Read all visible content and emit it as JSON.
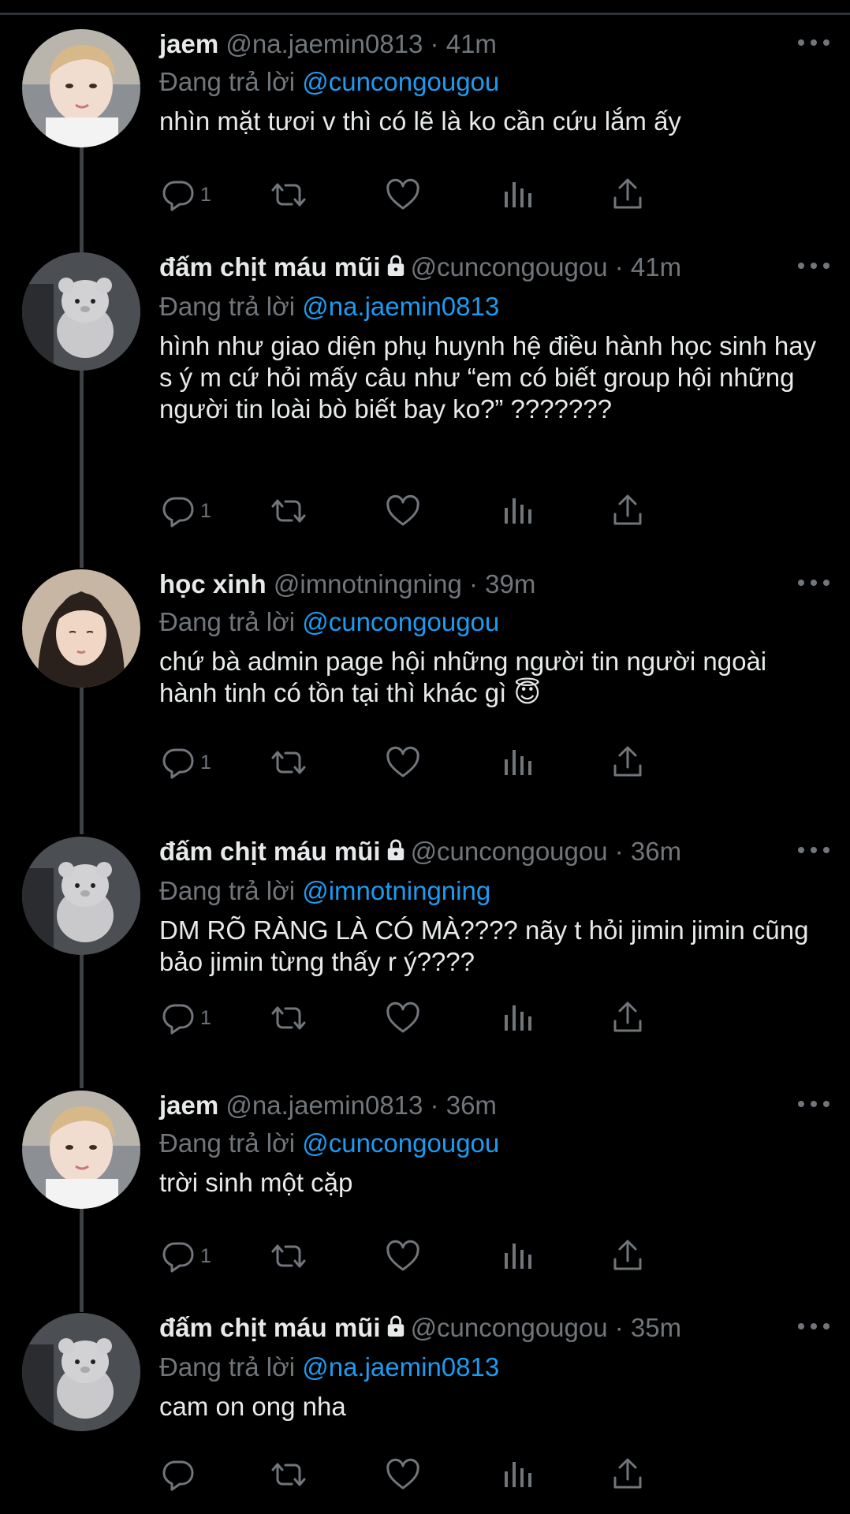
{
  "tweets": [
    {
      "name": "jaem",
      "handle": "@na.jaemin0813",
      "time": "41m",
      "locked": false,
      "reply_label": "Đang trả lời",
      "reply_to": "@cuncongougou",
      "text": "nhìn mặt tươi v thì có lẽ là ko cần cứu lắm ấy",
      "reply_count": "1",
      "avatar": "jaem-avatar"
    },
    {
      "name": "đấm chịt máu mũi",
      "handle": "@cuncongougou",
      "time": "41m",
      "locked": true,
      "reply_label": "Đang trả lời",
      "reply_to": "@na.jaemin0813",
      "text": "hình như giao diện phụ huynh hệ điều hành học sinh hay s ý m cứ hỏi mấy câu như “em có biết group hội những người tin loài bò biết bay ko?” ???????",
      "reply_count": "1",
      "avatar": "bear-avatar"
    },
    {
      "name": "học xinh",
      "handle": "@imnotningning",
      "time": "39m",
      "locked": false,
      "reply_label": "Đang trả lời",
      "reply_to": "@cuncongougou",
      "text": "chứ bà admin page hội những người tin người ngoài hành tinh có tồn tại thì khác gì 😇",
      "reply_count": "1",
      "avatar": "girl-avatar"
    },
    {
      "name": "đấm chịt máu mũi",
      "handle": "@cuncongougou",
      "time": "36m",
      "locked": true,
      "reply_label": "Đang trả lời",
      "reply_to": "@imnotningning",
      "text": "DM RÕ RÀNG LÀ CÓ MÀ???? nãy t hỏi jimin jimin cũng bảo jimin từng thấy r ý????",
      "reply_count": "1",
      "avatar": "bear-avatar"
    },
    {
      "name": "jaem",
      "handle": "@na.jaemin0813",
      "time": "36m",
      "locked": false,
      "reply_label": "Đang trả lời",
      "reply_to": "@cuncongougou",
      "text": "trời sinh một cặp",
      "reply_count": "1",
      "avatar": "jaem-avatar"
    },
    {
      "name": "đấm chịt máu mũi",
      "handle": "@cuncongougou",
      "time": "35m",
      "locked": true,
      "reply_label": "Đang trả lời",
      "reply_to": "@na.jaemin0813",
      "text": "cam on ong nha",
      "reply_count": "",
      "avatar": "bear-avatar"
    }
  ],
  "icons": {
    "reply": "reply-icon",
    "retweet": "retweet-icon",
    "like": "like-icon",
    "views": "views-icon",
    "share": "share-icon",
    "more": "more-icon",
    "lock": "lock-icon"
  },
  "colors": {
    "background": "#000000",
    "text": "#e7e9ea",
    "muted": "#71767b",
    "mention": "#1d9bf0"
  }
}
